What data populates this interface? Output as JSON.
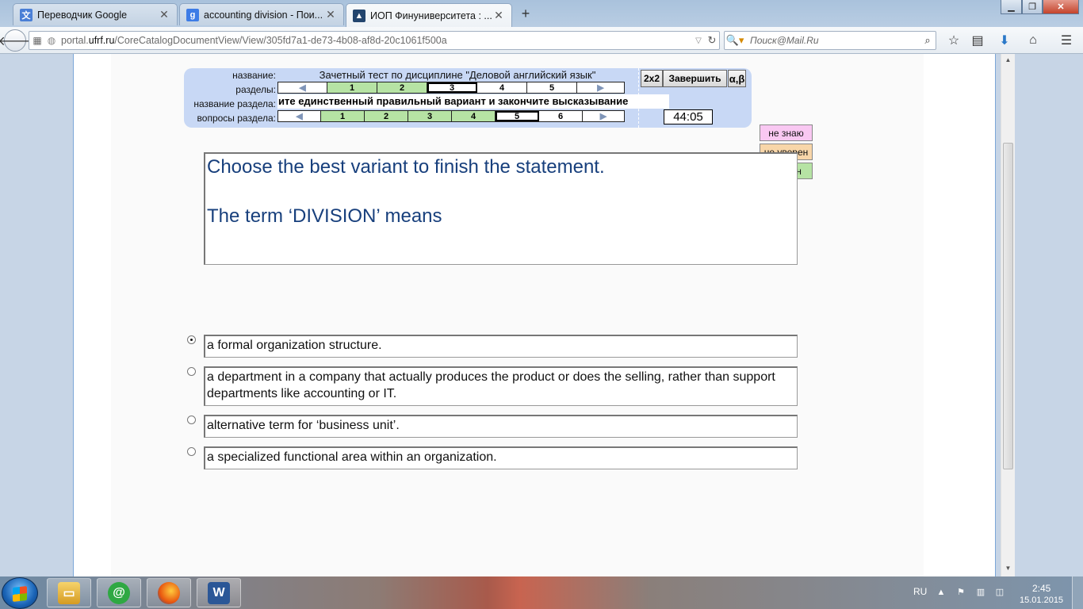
{
  "browser": {
    "tabs": [
      {
        "label": "Переводчик Google",
        "icon": "google-translate-icon"
      },
      {
        "label": "accounting division - Пои...",
        "icon": "google-search-icon"
      },
      {
        "label": "ИОП Финуниверситета : ...",
        "icon": "graduation-cap-icon",
        "active": true
      }
    ],
    "new_tab": "+",
    "url_prefix": "portal.",
    "url_domain": "ufrf.ru",
    "url_path": "/CoreCatalogDocumentView/View/305fd7a1-de73-4b08-af8d-20c1061f500a",
    "search_placeholder": "Поиск@Mail.Ru"
  },
  "test": {
    "labels": {
      "name": "название:",
      "sections": "разделы:",
      "section_name": "название раздела:",
      "section_questions": "вопросы раздела:"
    },
    "title": "Зачетный тест по дисциплине \"Деловой английский язык\"",
    "section_title": "ите единственный правильный вариант и закончите высказывание",
    "sections": [
      {
        "label": "1",
        "state": "done"
      },
      {
        "label": "2",
        "state": "done"
      },
      {
        "label": "3",
        "state": "current"
      },
      {
        "label": "4",
        "state": "open"
      },
      {
        "label": "5",
        "state": "open"
      }
    ],
    "questions": [
      {
        "label": "1",
        "state": "done"
      },
      {
        "label": "2",
        "state": "done"
      },
      {
        "label": "3",
        "state": "done"
      },
      {
        "label": "4",
        "state": "done"
      },
      {
        "label": "5",
        "state": "current"
      },
      {
        "label": "6",
        "state": "open"
      }
    ],
    "prev_arrow": "◀",
    "next_arrow": "▶",
    "buttons": {
      "grid": "2x2",
      "finish": "Завершить",
      "alpha_beta": "α,β"
    },
    "timer": "44:05",
    "confidence": {
      "dont_know": "не знаю",
      "not_sure": "не уверен",
      "sure": "уверен"
    },
    "colors": {
      "panel": "#c8d8f5",
      "done": "#b6e3a4",
      "dont_know": "#f9c8f2",
      "not_sure": "#f8d6a9",
      "sure": "#b6e3a4",
      "question_text": "#173f7c"
    }
  },
  "question": {
    "line1": "Choose the best variant to finish the statement.",
    "line2": "The term ‘DIVISION’ means"
  },
  "answers": [
    {
      "text": "a formal organization structure.",
      "selected": true
    },
    {
      "text": "a department in a company that actually produces the product or does the selling, rather than support departments like accounting or IT.",
      "selected": false
    },
    {
      "text": "alternative term for ‘business unit’.",
      "selected": false
    },
    {
      "text": "a specialized functional area within an organization.",
      "selected": false
    }
  ],
  "taskbar": {
    "apps": [
      "file-explorer-icon",
      "mail-ru-agent-icon",
      "firefox-icon",
      "word-icon"
    ],
    "language": "RU",
    "time": "2:45",
    "date": "15.01.2015"
  }
}
